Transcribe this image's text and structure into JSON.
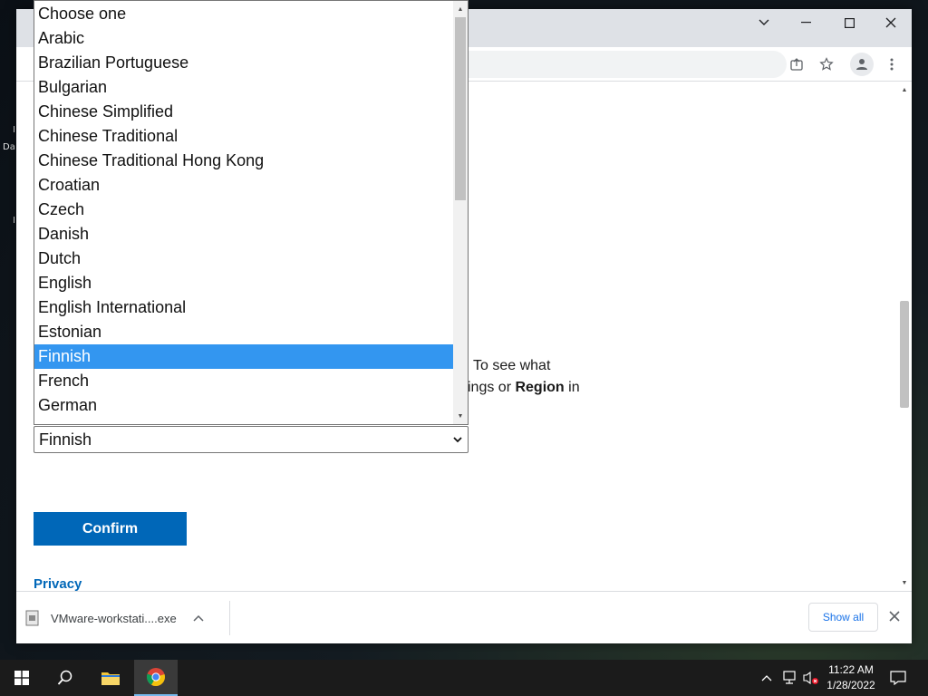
{
  "desktop": {
    "icon_fragments": [
      "I",
      "Da",
      "I"
    ]
  },
  "browser": {
    "page": {
      "partial_text_line1_right": "To see what",
      "partial_text_line2_right_a": "ings or ",
      "partial_text_line2_bold": "Region",
      "partial_text_line2_right_b": " in",
      "language_select_value": "Finnish",
      "confirm_label": "Confirm",
      "privacy_label": "Privacy"
    },
    "dropdown": {
      "options": [
        "Choose one",
        "Arabic",
        "Brazilian Portuguese",
        "Bulgarian",
        "Chinese Simplified",
        "Chinese Traditional",
        "Chinese Traditional Hong Kong",
        "Croatian",
        "Czech",
        "Danish",
        "Dutch",
        "English",
        "English International",
        "Estonian",
        "Finnish",
        "French",
        "German"
      ],
      "selected": "Finnish"
    },
    "download_bar": {
      "file_name": "VMware-workstati....exe",
      "show_all_label": "Show all"
    }
  },
  "taskbar": {
    "time": "11:22 AM",
    "date": "1/28/2022",
    "active_app": "chrome"
  },
  "colors": {
    "accent": "#0067b8",
    "selection": "#3396f0",
    "link": "#0067b8"
  }
}
